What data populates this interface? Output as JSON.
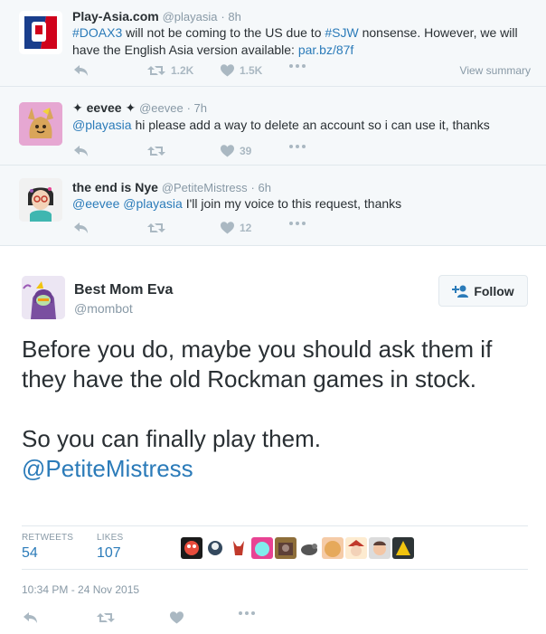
{
  "tweets": [
    {
      "name": "Play-Asia.com",
      "handle": "@playasia",
      "time": "· 8h",
      "text_parts": {
        "p1": "#DOAX3",
        "p2": " will not be coming to the US due to ",
        "p3": "#SJW",
        "p4": " nonsense. However, we will have the English Asia version available: ",
        "p5": "par.bz/87f"
      },
      "retweets": "1.2K",
      "likes": "1.5K",
      "view_summary": "View summary"
    },
    {
      "name": "eevee",
      "name_prefix": "✦",
      "name_suffix": "✦",
      "handle": "@eevee",
      "time": "· 7h",
      "text_parts": {
        "p1": "@playasia",
        "p2": " hi please add a way to delete an account so i can use it, thanks"
      },
      "likes": "39"
    },
    {
      "name": "the end is Nye",
      "handle": "@PetiteMistress",
      "time": "· 6h",
      "text_parts": {
        "p1": "@eevee",
        "p2": " ",
        "p3": "@playasia",
        "p4": " I'll join my voice to this request, thanks"
      },
      "likes": "12"
    }
  ],
  "main_tweet": {
    "name": "Best Mom Eva",
    "handle": "@mombot",
    "follow_label": "Follow",
    "text": "Before you do, maybe you should ask them if they have the old Rockman games in stock.\n\nSo you can finally play them.",
    "mention": "@PetiteMistress",
    "retweets_label": "RETWEETS",
    "retweets": "54",
    "likes_label": "LIKES",
    "likes": "107",
    "timestamp": "10:34 PM - 24 Nov 2015"
  },
  "colors": {
    "link": "#2b7bb9",
    "icon_gray": "#aab8c2",
    "meta_gray": "#8899a6",
    "reply_bg": "#f5f8fa"
  }
}
